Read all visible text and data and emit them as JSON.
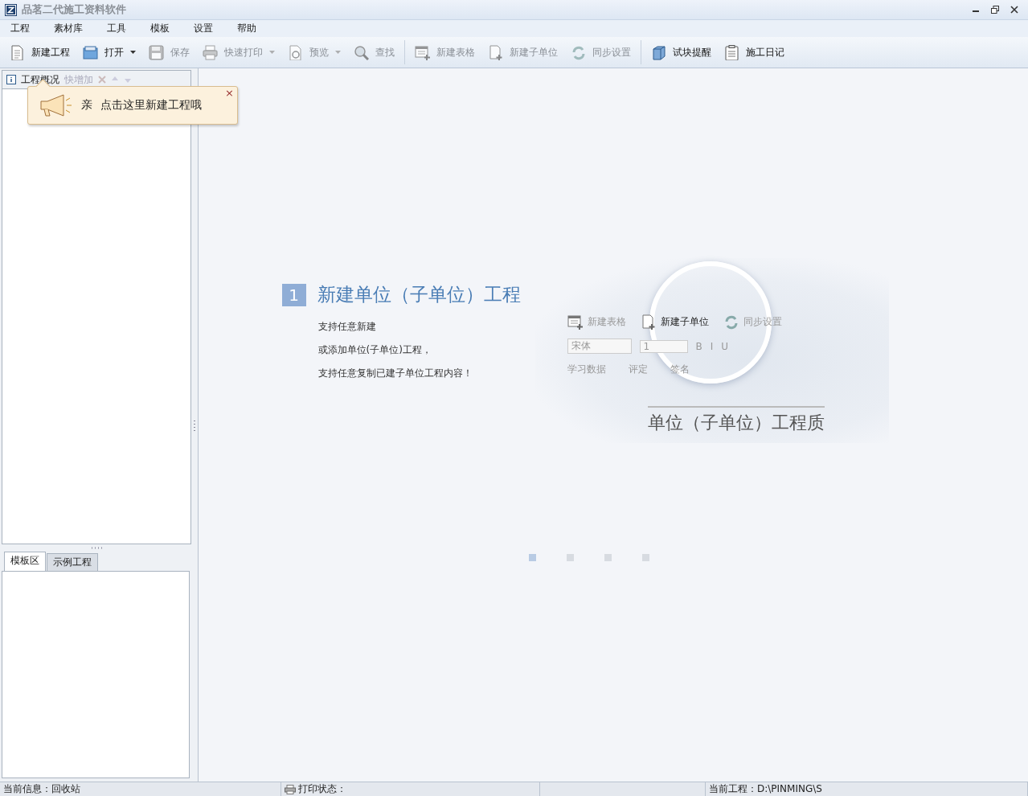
{
  "window": {
    "title": "品茗二代施工资料软件"
  },
  "menu": [
    "工程",
    "素材库",
    "工具",
    "模板",
    "设置",
    "帮助"
  ],
  "toolbar": [
    [
      {
        "label": "新建工程",
        "kind": "button",
        "disabled": false
      },
      {
        "label": "打开",
        "kind": "dropdown",
        "disabled": false
      },
      {
        "label": "保存",
        "kind": "button",
        "disabled": true
      },
      {
        "label": "快速打印",
        "kind": "dropdown",
        "disabled": true
      },
      {
        "label": "预览",
        "kind": "dropdown",
        "disabled": true
      },
      {
        "label": "查找",
        "kind": "button",
        "disabled": true
      }
    ],
    [
      {
        "label": "新建表格",
        "kind": "button",
        "disabled": true
      },
      {
        "label": "新建子单位",
        "kind": "button",
        "disabled": true
      },
      {
        "label": "同步设置",
        "kind": "button",
        "disabled": true
      }
    ],
    [
      {
        "label": "试块提醒",
        "kind": "button",
        "disabled": false
      },
      {
        "label": "施工日记",
        "kind": "button",
        "disabled": false
      }
    ]
  ],
  "project_panel": {
    "tabs": [
      {
        "label": "工程概况",
        "disabled": false
      },
      {
        "label": "快增加",
        "disabled": true
      }
    ]
  },
  "tooltip": {
    "greeting": "亲",
    "text": "点击这里新建工程哦",
    "close": "×"
  },
  "bottom_tabs": [
    {
      "label": "模板区",
      "selected": true
    },
    {
      "label": "示例工程",
      "selected": false
    }
  ],
  "welcome": {
    "step": "1",
    "heading": "新建单位（子单位）工程",
    "lines": [
      "支持任意新建",
      "或添加单位(子单位)工程，",
      "支持任意复制已建子单位工程内容！"
    ],
    "illustration": {
      "buttons": [
        "新建表格",
        "新建子单位",
        "同步设置"
      ],
      "font": "宋体",
      "font_size": "1",
      "format": [
        "B",
        "I",
        "U"
      ],
      "row2": [
        "学习数据",
        "评定",
        "签名"
      ],
      "doc_title": "单位（子单位）工程质"
    },
    "pages": [
      {
        "selected": true
      },
      {
        "selected": false
      },
      {
        "selected": false
      },
      {
        "selected": false
      }
    ]
  },
  "status_bar": {
    "info": "当前信息：回收站",
    "print": "打印状态：",
    "project": "当前工程：D:\\PINMING\\S"
  }
}
